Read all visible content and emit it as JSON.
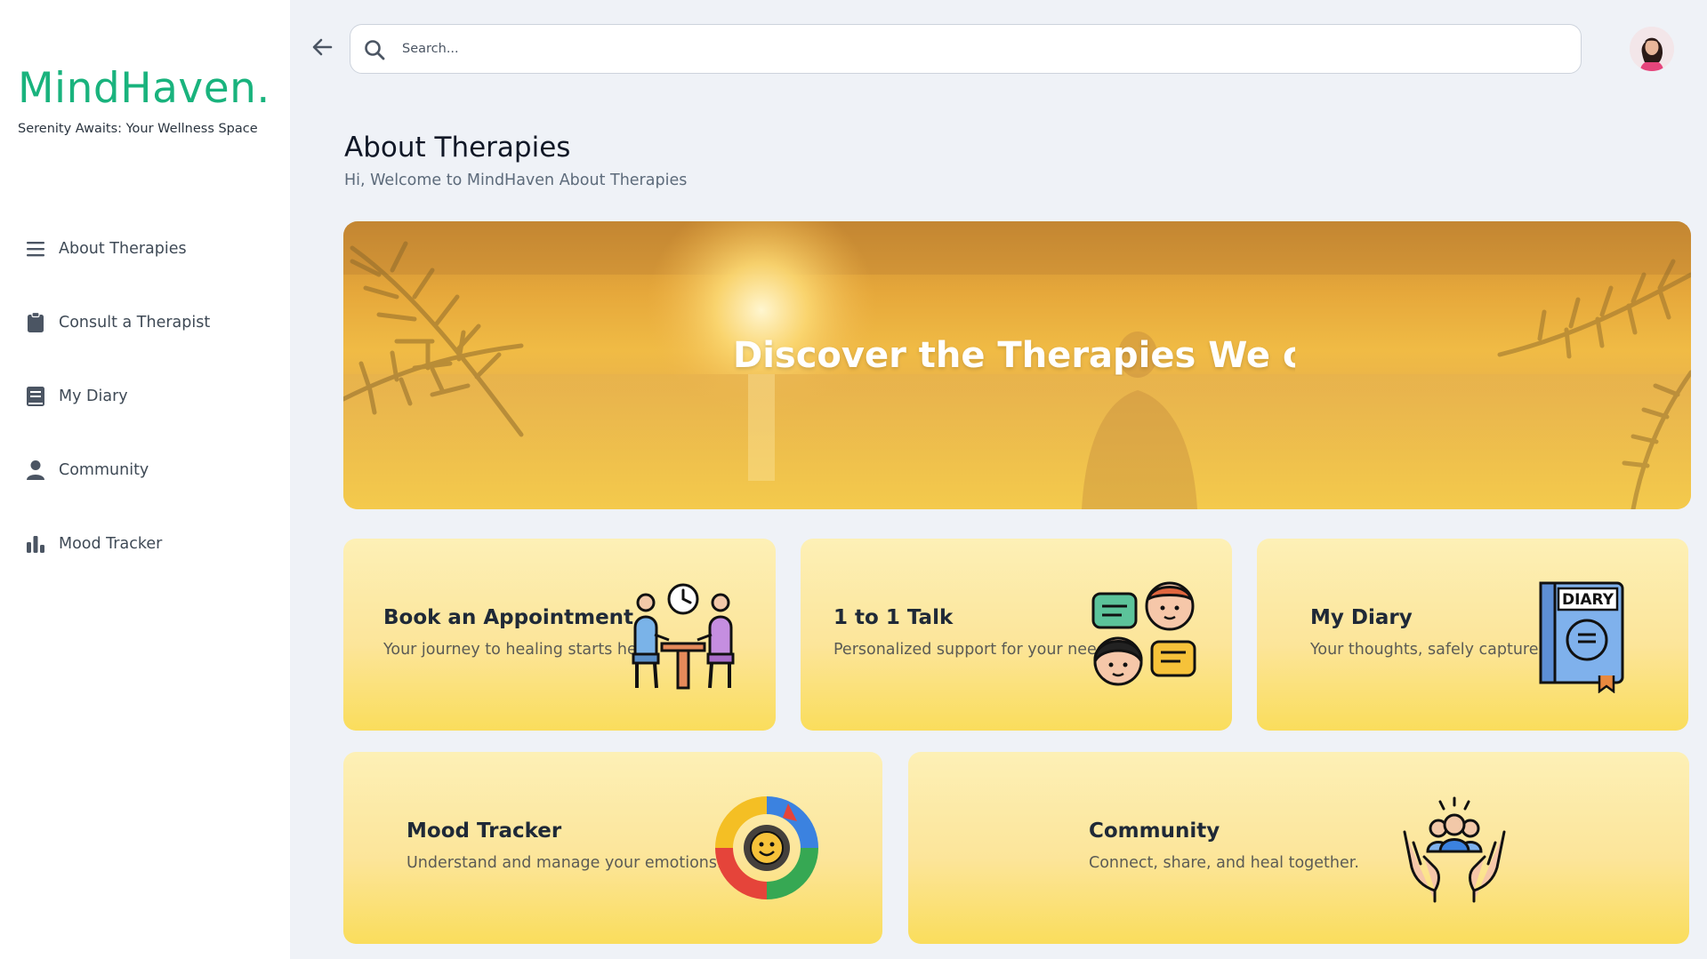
{
  "sidebar": {
    "brand": "MindHaven.",
    "tagline": "Serenity Awaits: Your Wellness Space",
    "items": [
      {
        "label": "About Therapies",
        "icon": "menu-icon"
      },
      {
        "label": "Consult a Therapist",
        "icon": "clipboard-icon"
      },
      {
        "label": "My Diary",
        "icon": "book-icon"
      },
      {
        "label": "Community",
        "icon": "user-icon"
      },
      {
        "label": "Mood Tracker",
        "icon": "bar-chart-icon"
      }
    ]
  },
  "topbar": {
    "search_placeholder": "Search...",
    "back_icon": "arrow-left-icon",
    "search_icon": "search-icon",
    "avatar_icon": "user-avatar"
  },
  "page": {
    "title": "About Therapies",
    "subtitle": "Hi, Welcome to MindHaven About Therapies"
  },
  "hero": {
    "text": "Discover the Therapies We offer for you"
  },
  "cards": [
    {
      "title": "Book an Appointment",
      "desc": "Your journey to healing starts here.",
      "icon": "appointment-meeting-icon"
    },
    {
      "title": "1 to 1 Talk",
      "desc": "Personalized support for your needs.",
      "icon": "chat-people-icon"
    },
    {
      "title": "My Diary",
      "desc": "Your thoughts, safely captured.",
      "icon": "diary-book-icon",
      "icon_label": "DIARY"
    },
    {
      "title": "Mood Tracker",
      "desc": "Understand and manage your emotions.",
      "icon": "mood-gauge-icon"
    },
    {
      "title": "Community",
      "desc": "Connect, share, and heal together.",
      "icon": "community-hands-icon"
    }
  ],
  "colors": {
    "brand": "#19b37d",
    "card_top": "#fdf0b6",
    "card_bottom": "#fadd5c",
    "background": "#eff2f7"
  }
}
